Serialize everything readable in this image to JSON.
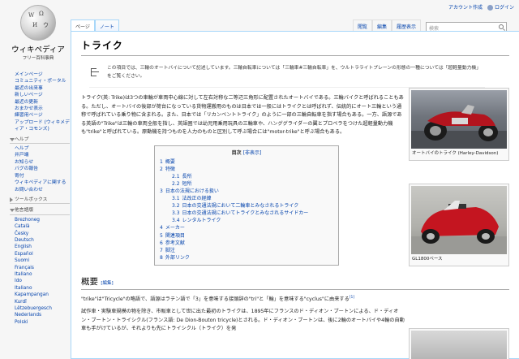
{
  "personal": {
    "create_account": "アカウント作成",
    "login": "ログイン"
  },
  "logo": {
    "title": "ウィキペディア",
    "subtitle": "フリー百科事典"
  },
  "sidebar": {
    "main_links": [
      "メインページ",
      "コミュニティ・ポータル",
      "最近の出来事",
      "新しいページ",
      "最近の更新",
      "おまかせ表示",
      "練習用ページ",
      "アップロード (ウィキメディア・コモンズ)"
    ],
    "help_head": "ヘルプ",
    "help_links": [
      "ヘルプ",
      "井戸端",
      "お知らせ",
      "バグの報告",
      "寄付",
      "ウィキペディアに関するお問い合わせ"
    ],
    "toolbox_head": "ツールボックス",
    "lang_head": "他言語版",
    "languages": [
      "Brezhoneg",
      "Català",
      "Česky",
      "Deutsch",
      "English",
      "Español",
      "Suomi",
      "Français",
      "Italiano",
      "Ido",
      "Italiano",
      "Kapampangan",
      "Kurdî",
      "Lëtzebuergesch",
      "Nederlands",
      "Polski"
    ]
  },
  "tabs": {
    "page": "ページ",
    "note": "ノート",
    "read": "閲覧",
    "edit": "編集",
    "history": "履歴表示",
    "search_placeholder": "検索"
  },
  "article": {
    "title": "トライク",
    "hatnote": "この項目では、三輪のオートバイについて記述しています。三輪自転車については「三輪車#三輪自転車」を、ウルトラライトプレーンの形態の一種については「超軽量動力機」をご覧ください。",
    "lead_1": "トライク(英: Trike)は3つの車輪が車両中心線に対して左右対称な二等辺三角形に配置されたオートバイである。三輪バイクと呼ばれることもある。ただし、オートバイの後部が荷台になっている貨物運搬用のものは日本では一般にはトライクとは呼ばれず、伝統的にオート三輪という通称で呼ばれている乗り物に含まれる。また、日本では「リカンベントトライク」のように一部の三輪自転車を指す場合もある。一方、語源である英語の\"Trike\"は三輪の車両全般を指し、英語圏では幼児用乗用玩具の三輪車や、ハンググライダーの翼とプロペラをつけた超軽量動力機も\"trike\"と呼ばれている。原動機を持つものを人力のものと区別して呼ぶ場合には\"motor-trike\"と呼ぶ場合もある。",
    "thumb1_caption": "オートバイのトライク (Harley-Davidson)",
    "thumb2_caption": "GL1800ベース",
    "toc_title": "目次",
    "toc_toggle": "[非表示]",
    "toc": [
      {
        "num": "1",
        "text": "概要",
        "level": 1
      },
      {
        "num": "2",
        "text": "特徴",
        "level": 1
      },
      {
        "num": "2.1",
        "text": "長所",
        "level": 2
      },
      {
        "num": "2.2",
        "text": "短所",
        "level": 2
      },
      {
        "num": "3",
        "text": "日本の法規における扱い",
        "level": 1
      },
      {
        "num": "3.1",
        "text": "法改正の経緯",
        "level": 2
      },
      {
        "num": "3.2",
        "text": "日本の交通法規において二輪車とみなされるトライク",
        "level": 2
      },
      {
        "num": "3.3",
        "text": "日本の交通法規においてトライクとみなされるサイドカー",
        "level": 2
      },
      {
        "num": "3.4",
        "text": "レンタルトライク",
        "level": 2
      },
      {
        "num": "4",
        "text": "メーカー",
        "level": 1
      },
      {
        "num": "5",
        "text": "関連項目",
        "level": 1
      },
      {
        "num": "6",
        "text": "参考文献",
        "level": 1
      },
      {
        "num": "7",
        "text": "脚注",
        "level": 1
      },
      {
        "num": "8",
        "text": "外部リンク",
        "level": 1
      }
    ],
    "section1_title": "概要",
    "section1_edit": "[編集]",
    "section1_p1": "\"trike\"は\"Tricycle\"の略語で、語源はラテン語で「3」を意味する接頭辞の\"tri\"と「輪」を意味する\"cyclus\"に由来する",
    "section1_ref": "[1]",
    "section1_p2": "試作車・実験車規模の物を除き、市販車として世に出た最初のトライクは、1895年にフランスのド・ディオン・ブートンによる、ド・ディオン・ブートン・トライシクル(フランス語: De Dion-Bouton tricycle)とされる。ド・ディオン・ブートンは、後に2輪のオートバイや4輪の自動車も手がけているが、それよりも先にトライシクル（トライク）を発"
  },
  "colors": {
    "link": "#0645ad",
    "border": "#a7d7f9",
    "redlink": "#ba0000"
  }
}
